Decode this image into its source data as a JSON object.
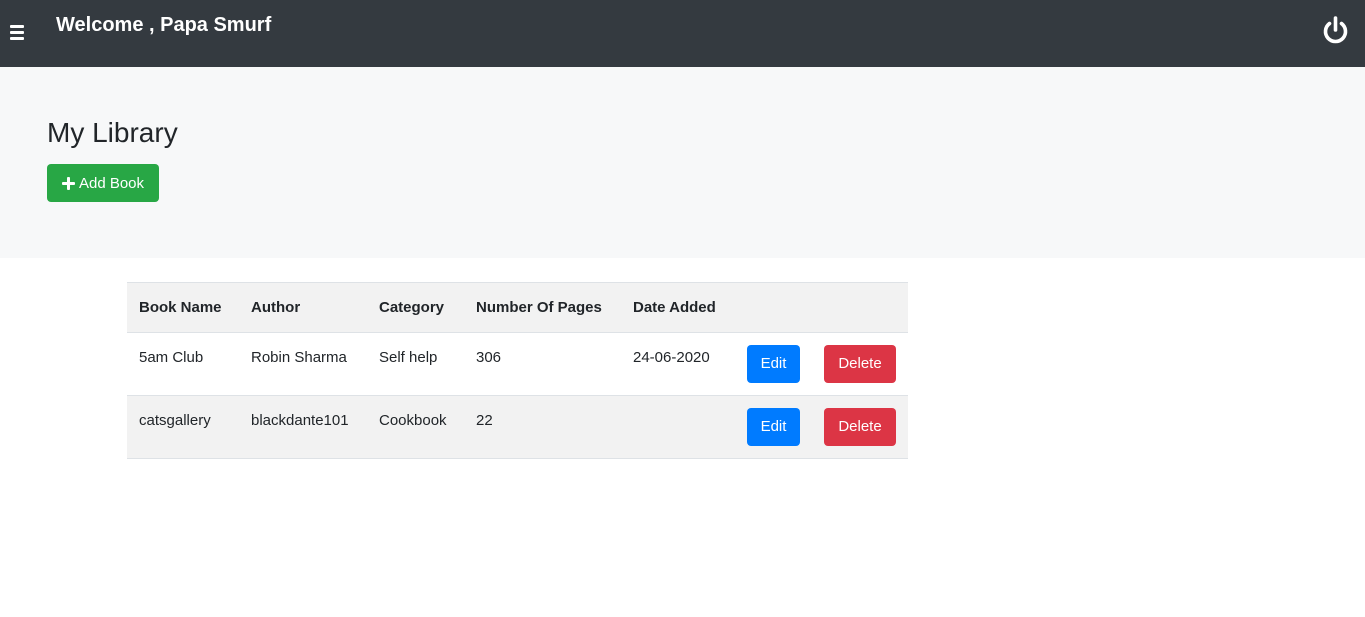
{
  "navbar": {
    "welcome_text": "Welcome , Papa Smurf",
    "menu_icon": "hamburger-menu-icon",
    "power_icon": "power-icon",
    "background": "#343a40"
  },
  "header": {
    "title": "My Library",
    "add_button_label": "Add Book",
    "add_button_color": "#28a745"
  },
  "table": {
    "columns": [
      "Book Name",
      "Author",
      "Category",
      "Number Of Pages",
      "Date Added"
    ],
    "rows": [
      {
        "book_name": "5am Club",
        "author": "Robin Sharma",
        "category": "Self help",
        "pages": "306",
        "date_added": "24-06-2020",
        "edit_label": "Edit",
        "delete_label": "Delete"
      },
      {
        "book_name": "catsgallery",
        "author": "blackdante101",
        "category": "Cookbook",
        "pages": "22",
        "date_added": "",
        "edit_label": "Edit",
        "delete_label": "Delete"
      }
    ]
  },
  "colors": {
    "edit": "#007bff",
    "delete": "#dc3545"
  }
}
